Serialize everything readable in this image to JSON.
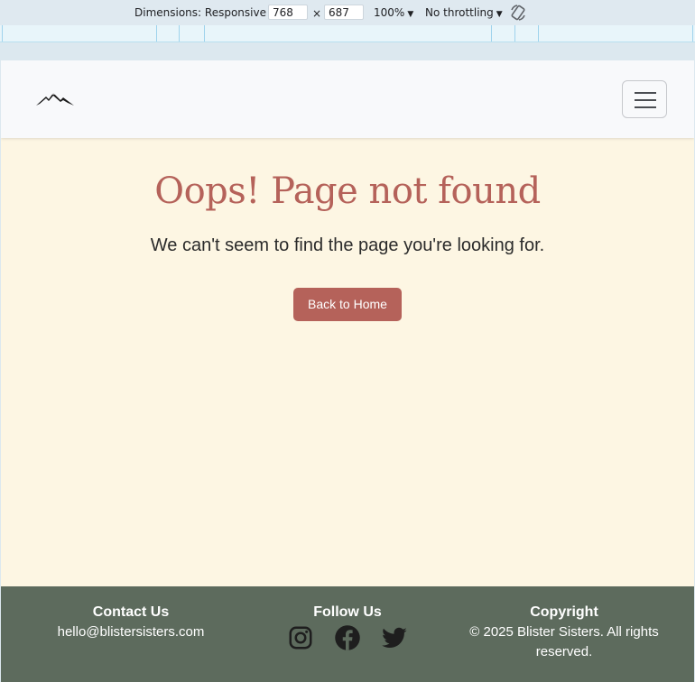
{
  "devtools": {
    "dimensions_label": "Dimensions: Responsive",
    "width_value": "768",
    "times": "×",
    "height_value": "687",
    "zoom": "100%",
    "throttling": "No throttling"
  },
  "site": {
    "nav": {
      "logo_icon": "mountain-icon",
      "toggle_icon": "hamburger-icon"
    },
    "main": {
      "title": "Oops! Page not found",
      "message": "We can't seem to find the page you're looking for.",
      "button_label": "Back to Home"
    },
    "footer": {
      "contact_heading": "Contact Us",
      "contact_email": "hello@blistersisters.com",
      "follow_heading": "Follow Us",
      "social_icons": [
        "instagram-icon",
        "facebook-icon",
        "twitter-icon"
      ],
      "copyright_heading": "Copyright",
      "copyright_text": "© 2025 Blister Sisters. All rights reserved."
    }
  },
  "colors": {
    "accent": "#b5625a",
    "background": "#fdf6e3",
    "footer": "#5d6b5d",
    "navbar": "#f8f9fb"
  }
}
